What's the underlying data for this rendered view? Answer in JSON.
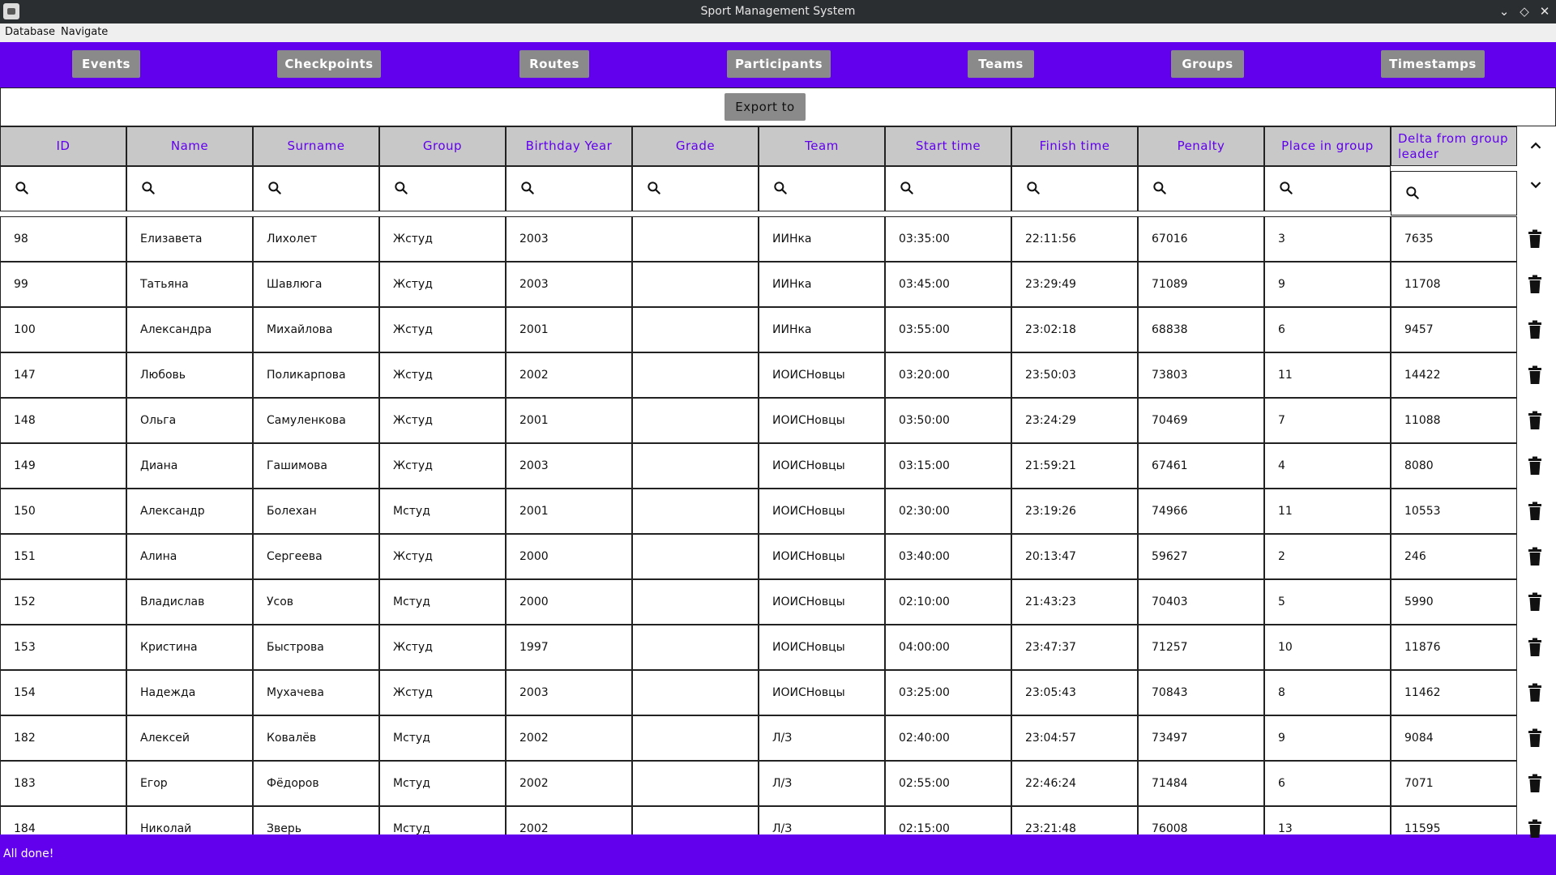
{
  "window": {
    "title": "Sport Management System"
  },
  "menu": {
    "database": "Database",
    "navigate": "Navigate"
  },
  "nav": {
    "events": "Events",
    "checkpoints": "Checkpoints",
    "routes": "Routes",
    "participants": "Participants",
    "teams": "Teams",
    "groups": "Groups",
    "timestamps": "Timestamps"
  },
  "export_label": "Export to csv",
  "table": {
    "headers": [
      "ID",
      "Name",
      "Surname",
      "Group",
      "Birthday Year",
      "Grade",
      "Team",
      "Start time",
      "Finish time",
      "Penalty",
      "Place in group",
      "Delta from group leader"
    ],
    "rows": [
      [
        "98",
        "Елизавета",
        "Лихолет",
        "Жстуд",
        "2003",
        "",
        "ИИНка",
        "03:35:00",
        "22:11:56",
        "67016",
        "3",
        "7635"
      ],
      [
        "99",
        "Татьяна",
        "Шавлюга",
        "Жстуд",
        "2003",
        "",
        "ИИНка",
        "03:45:00",
        "23:29:49",
        "71089",
        "9",
        "11708"
      ],
      [
        "100",
        "Александра",
        "Михайлова",
        "Жстуд",
        "2001",
        "",
        "ИИНка",
        "03:55:00",
        "23:02:18",
        "68838",
        "6",
        "9457"
      ],
      [
        "147",
        "Любовь",
        "Поликарпова",
        "Жстуд",
        "2002",
        "",
        "ИОИСНовцы",
        "03:20:00",
        "23:50:03",
        "73803",
        "11",
        "14422"
      ],
      [
        "148",
        "Ольга",
        "Самуленкова",
        "Жстуд",
        "2001",
        "",
        "ИОИСНовцы",
        "03:50:00",
        "23:24:29",
        "70469",
        "7",
        "11088"
      ],
      [
        "149",
        "Диана",
        "Гашимова",
        "Жстуд",
        "2003",
        "",
        "ИОИСНовцы",
        "03:15:00",
        "21:59:21",
        "67461",
        "4",
        "8080"
      ],
      [
        "150",
        "Александр",
        "Болехан",
        "Мстуд",
        "2001",
        "",
        "ИОИСНовцы",
        "02:30:00",
        "23:19:26",
        "74966",
        "11",
        "10553"
      ],
      [
        "151",
        "Алина",
        "Сергеева",
        "Жстуд",
        "2000",
        "",
        "ИОИСНовцы",
        "03:40:00",
        "20:13:47",
        "59627",
        "2",
        "246"
      ],
      [
        "152",
        "Владислав",
        "Усов",
        "Мстуд",
        "2000",
        "",
        "ИОИСНовцы",
        "02:10:00",
        "21:43:23",
        "70403",
        "5",
        "5990"
      ],
      [
        "153",
        "Кристина",
        "Быстрова",
        "Жстуд",
        "1997",
        "",
        "ИОИСНовцы",
        "04:00:00",
        "23:47:37",
        "71257",
        "10",
        "11876"
      ],
      [
        "154",
        "Надежда",
        "Мухачева",
        "Жстуд",
        "2003",
        "",
        "ИОИСНовцы",
        "03:25:00",
        "23:05:43",
        "70843",
        "8",
        "11462"
      ],
      [
        "182",
        "Алексей",
        "Ковалёв",
        "Мстуд",
        "2002",
        "",
        "Л/З",
        "02:40:00",
        "23:04:57",
        "73497",
        "9",
        "9084"
      ],
      [
        "183",
        "Егор",
        "Фёдоров",
        "Мстуд",
        "2002",
        "",
        "Л/З",
        "02:55:00",
        "22:46:24",
        "71484",
        "6",
        "7071"
      ],
      [
        "184",
        "Николай",
        "Зверь",
        "Мстуд",
        "2002",
        "",
        "Л/З",
        "02:15:00",
        "23:21:48",
        "76008",
        "13",
        "11595"
      ]
    ]
  },
  "status": {
    "message": "All done!"
  },
  "colors": {
    "accent": "#6200ee",
    "header_bg": "#c8c8c8",
    "button_bg": "#8a8a8a"
  }
}
